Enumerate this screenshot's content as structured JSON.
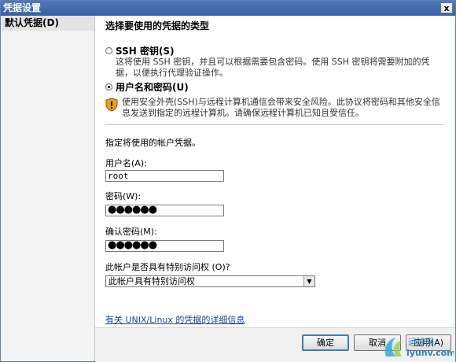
{
  "window": {
    "title": "凭据设置",
    "close_glyph": "x"
  },
  "sidebar": {
    "items": [
      {
        "label": "默认凭据(D)"
      }
    ]
  },
  "main": {
    "heading": "选择要使用的凭据的类型",
    "options": [
      {
        "label": "SSH 密钥(S)",
        "selected": false,
        "description": "这将使用 SSH 密钥，并且可以根据需要包含密码。使用 SSH 密钥将需要附加的凭据，以便执行代理验证操作。"
      },
      {
        "label": "用户名和密码(U)",
        "selected": true
      }
    ],
    "warning": "使用安全外壳(SSH)与远程计算机通信会带来安全风险。此协议将密码和其他安全信息发送到指定的远程计算机。请确保远程计算机已知且受信任。",
    "account_prompt": "指定将使用的帐户凭据。",
    "username": {
      "label": "用户名(A):",
      "value": "root"
    },
    "password": {
      "label": "密码(W):",
      "value": "●●●●●●"
    },
    "confirm_password": {
      "label": "确认密码(M):",
      "value": "●●●●●●"
    },
    "access": {
      "label": "此帐户是否具有特别访问权 (O)?",
      "selected": "此帐户具有特别访问权"
    },
    "link": "有关 UNIX/Linux 的凭据的详细信息"
  },
  "buttons": {
    "ok": "确定",
    "cancel": "取消",
    "apply": "应用(A)"
  },
  "watermark": {
    "text_cn": "运维网",
    "text_en": "iyunv.com"
  },
  "colors": {
    "title_bar": "#3562a8",
    "link": "#1a3ea8",
    "shield": "#e8a317"
  }
}
